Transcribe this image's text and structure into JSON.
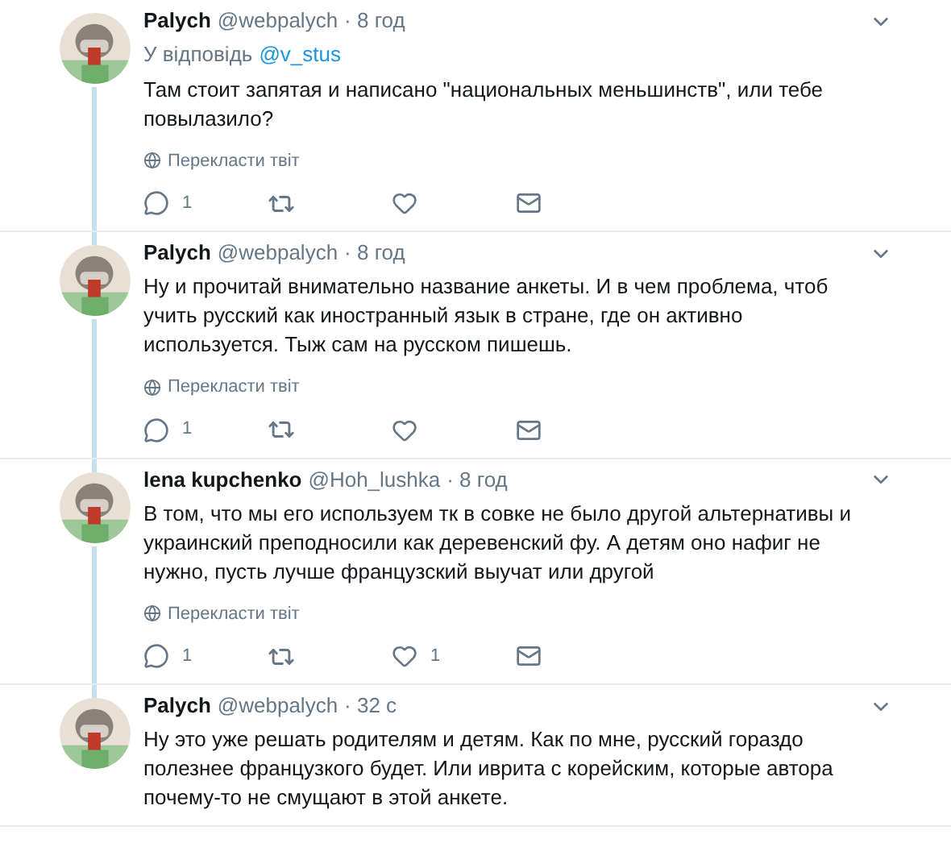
{
  "tweets": [
    {
      "name": "Palych",
      "handle": "@webpalych",
      "time": "· 8 год",
      "reply_label": "У відповідь",
      "reply_to": "@v_stus",
      "text": "Там стоит запятая и написано \"национальных меньшинств\", или тебе повылазило?",
      "translate": "Перекласти твіт",
      "replies": "1",
      "thread_above": false,
      "thread_below": true,
      "show_actions": true
    },
    {
      "name": "Palych",
      "handle": "@webpalych",
      "time": "· 8 год",
      "text": "Ну и прочитай внимательно название анкеты. И в чем проблема, чтоб учить русский как иностранный язык в стране, где он активно используется. Тыж сам на русском пишешь.",
      "translate": "Перекласти твіт",
      "replies": "1",
      "thread_above": true,
      "thread_below": true,
      "show_actions": true
    },
    {
      "name": "lena kupchenko",
      "handle": "@Hoh_lushka",
      "time": "· 8 год",
      "text": "В том, что мы его используем тк в совке не было другой альтернативы и украинский преподносили как деревенский фу. А детям оно нафиг не нужно, пусть лучше французский выучат или другой",
      "translate": "Перекласти твіт",
      "replies": "1",
      "likes": "1",
      "thread_above": true,
      "thread_below": true,
      "show_actions": true
    },
    {
      "name": "Palych",
      "handle": "@webpalych",
      "time": "· 32 с",
      "text": "Ну это уже решать родителям и детям. Как по мне, русский гораздо полезнее французкого будет. Или иврита с корейским, которые автора почему-то не смущают в этой анкете.",
      "thread_above": true,
      "thread_below": false,
      "show_actions": false
    }
  ]
}
